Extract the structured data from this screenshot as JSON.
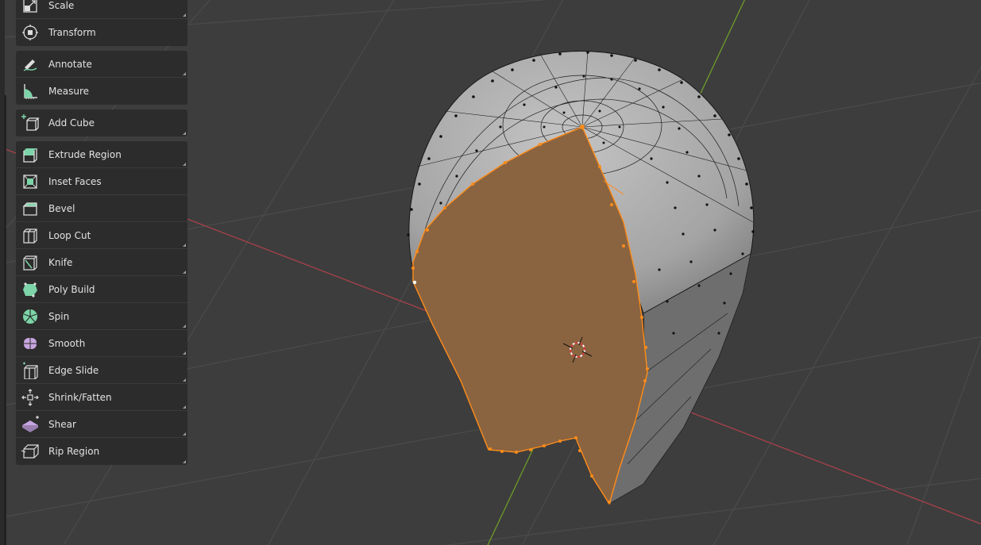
{
  "toolbar": {
    "groups": [
      {
        "tools": [
          {
            "label": "Scale",
            "icon": "scale-icon",
            "has_submenu": true
          },
          {
            "label": "Transform",
            "icon": "transform-icon",
            "has_submenu": false
          }
        ]
      },
      {
        "tools": [
          {
            "label": "Annotate",
            "icon": "annotate-icon",
            "has_submenu": true
          },
          {
            "label": "Measure",
            "icon": "measure-icon",
            "has_submenu": false
          }
        ]
      },
      {
        "tools": [
          {
            "label": "Add Cube",
            "icon": "add-cube-icon",
            "has_submenu": true
          }
        ]
      },
      {
        "tools": [
          {
            "label": "Extrude Region",
            "icon": "extrude-region-icon",
            "has_submenu": true
          },
          {
            "label": "Inset Faces",
            "icon": "inset-faces-icon",
            "has_submenu": false
          },
          {
            "label": "Bevel",
            "icon": "bevel-icon",
            "has_submenu": false
          },
          {
            "label": "Loop Cut",
            "icon": "loop-cut-icon",
            "has_submenu": true
          },
          {
            "label": "Knife",
            "icon": "knife-icon",
            "has_submenu": true
          },
          {
            "label": "Poly Build",
            "icon": "poly-build-icon",
            "has_submenu": false
          },
          {
            "label": "Spin",
            "icon": "spin-icon",
            "has_submenu": true
          },
          {
            "label": "Smooth",
            "icon": "smooth-icon",
            "has_submenu": true
          },
          {
            "label": "Edge Slide",
            "icon": "edge-slide-icon",
            "has_submenu": true
          },
          {
            "label": "Shrink/Fatten",
            "icon": "shrink-fatten-icon",
            "has_submenu": true
          },
          {
            "label": "Shear",
            "icon": "shear-icon",
            "has_submenu": true
          },
          {
            "label": "Rip Region",
            "icon": "rip-region-icon",
            "has_submenu": true
          }
        ]
      }
    ]
  },
  "viewport": {
    "background": "#3d3d3d",
    "grid_color": "#505050",
    "x_axis_color": "#b5404a",
    "y_axis_color": "#6e9a2c",
    "mesh_fill": "#9e9e9e",
    "selection_color": "#ff8c1a",
    "selected_face_fill": "#8a6440"
  }
}
